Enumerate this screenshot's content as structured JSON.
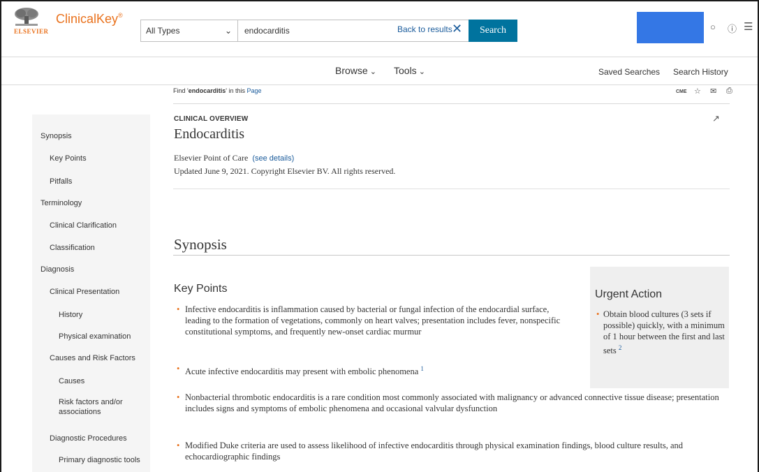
{
  "header": {
    "logo_publisher": "ELSEVIER",
    "logo_brand": "ClinicalKey",
    "logo_reg": "®",
    "search_type": "All Types",
    "search_value": "endocarditis",
    "back_to_results": "Back to results",
    "search_button": "Search"
  },
  "nav": {
    "browse": "Browse",
    "tools": "Tools",
    "saved_searches": "Saved Searches",
    "search_history": "Search History"
  },
  "find": {
    "prefix": "Find '",
    "term": "endocarditis",
    "suffix": "' in this ",
    "page_link": "Page"
  },
  "toolbar": {
    "cme": "CME"
  },
  "sidebar": {
    "items": [
      {
        "label": "Synopsis",
        "level": 0
      },
      {
        "label": "Key Points",
        "level": 1
      },
      {
        "label": "Pitfalls",
        "level": 1
      },
      {
        "label": "Terminology",
        "level": 0
      },
      {
        "label": "Clinical Clarification",
        "level": 1
      },
      {
        "label": "Classification",
        "level": 1
      },
      {
        "label": "Diagnosis",
        "level": 0
      },
      {
        "label": "Clinical Presentation",
        "level": 1
      },
      {
        "label": "History",
        "level": 2
      },
      {
        "label": "Physical examination",
        "level": 2
      },
      {
        "label": "Causes and Risk Factors",
        "level": 1
      },
      {
        "label": "Causes",
        "level": 2
      },
      {
        "label": "Risk factors and/or associations",
        "level": 2
      },
      {
        "label": "Diagnostic Procedures",
        "level": 1
      },
      {
        "label": "Primary diagnostic tools",
        "level": 2
      }
    ]
  },
  "article": {
    "category": "CLINICAL OVERVIEW",
    "title": "Endocarditis",
    "source": "Elsevier Point of Care",
    "see_details": "(see details)",
    "updated": "Updated June 9, 2021. Copyright Elsevier BV. All rights reserved.",
    "section_title": "Synopsis",
    "key_points_title": "Key Points",
    "key_points": [
      {
        "text": "Infective endocarditis is inflammation caused by bacterial or fungal infection of the endocardial surface, leading to the formation of vegetations, commonly on heart valves; presentation includes fever, nonspecific constitutional symptoms, and frequently new-onset cardiac murmur",
        "ref": ""
      },
      {
        "text": "Acute infective endocarditis may present with embolic phenomena",
        "ref": "1"
      },
      {
        "text": "Nonbacterial thrombotic endocarditis is a rare condition most commonly associated with malignancy or advanced connective tissue disease; presentation includes signs and symptoms of embolic phenomena and occasional valvular dysfunction",
        "ref": ""
      },
      {
        "text": "Modified Duke criteria are used to assess likelihood of infective endocarditis through physical examination findings, blood culture results, and echocardiographic findings",
        "ref": ""
      }
    ],
    "urgent_title": "Urgent Action",
    "urgent_text": "Obtain blood cultures (3 sets if possible) quickly, with a minimum of 1 hour between the first and last sets",
    "urgent_ref": "2"
  }
}
